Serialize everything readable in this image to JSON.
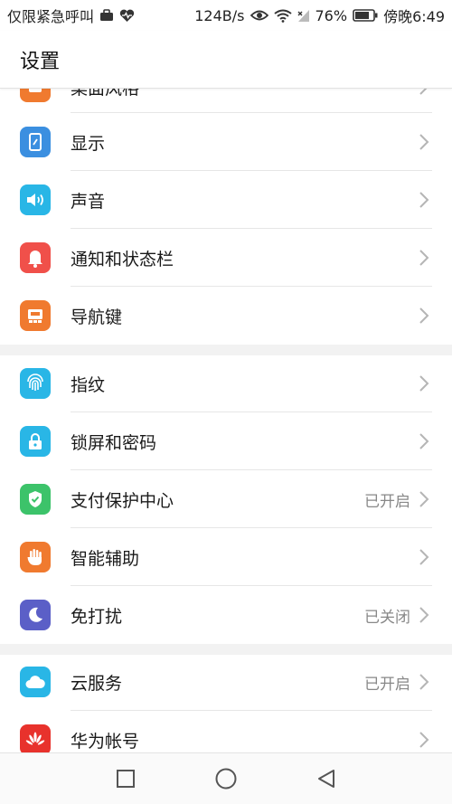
{
  "status_bar": {
    "carrier": "仅限紧急呼叫",
    "speed": "124B/s",
    "battery": "76%",
    "time": "傍晚6:49"
  },
  "title": "设置",
  "items": [
    {
      "label": "桌面风格",
      "value": "",
      "icon": "home-style-icon",
      "color": "#f07a2f"
    },
    {
      "label": "显示",
      "value": "",
      "icon": "display-icon",
      "color": "#3b8fe0"
    },
    {
      "label": "声音",
      "value": "",
      "icon": "speaker-icon",
      "color": "#29b6e6"
    },
    {
      "label": "通知和状态栏",
      "value": "",
      "icon": "bell-icon",
      "color": "#f0504a"
    },
    {
      "label": "导航键",
      "value": "",
      "icon": "nav-keys-icon",
      "color": "#f07a2f"
    },
    {
      "label": "指纹",
      "value": "",
      "icon": "fingerprint-icon",
      "color": "#29b6e6"
    },
    {
      "label": "锁屏和密码",
      "value": "",
      "icon": "lock-icon",
      "color": "#29b6e6"
    },
    {
      "label": "支付保护中心",
      "value": "已开启",
      "icon": "shield-check-icon",
      "color": "#3cc36a"
    },
    {
      "label": "智能辅助",
      "value": "",
      "icon": "hand-icon",
      "color": "#f07a2f"
    },
    {
      "label": "免打扰",
      "value": "已关闭",
      "icon": "moon-icon",
      "color": "#5b5fc7"
    },
    {
      "label": "云服务",
      "value": "已开启",
      "icon": "cloud-icon",
      "color": "#29b6e6"
    },
    {
      "label": "华为帐号",
      "value": "",
      "icon": "huawei-logo-icon",
      "color": "#e8322c"
    }
  ]
}
